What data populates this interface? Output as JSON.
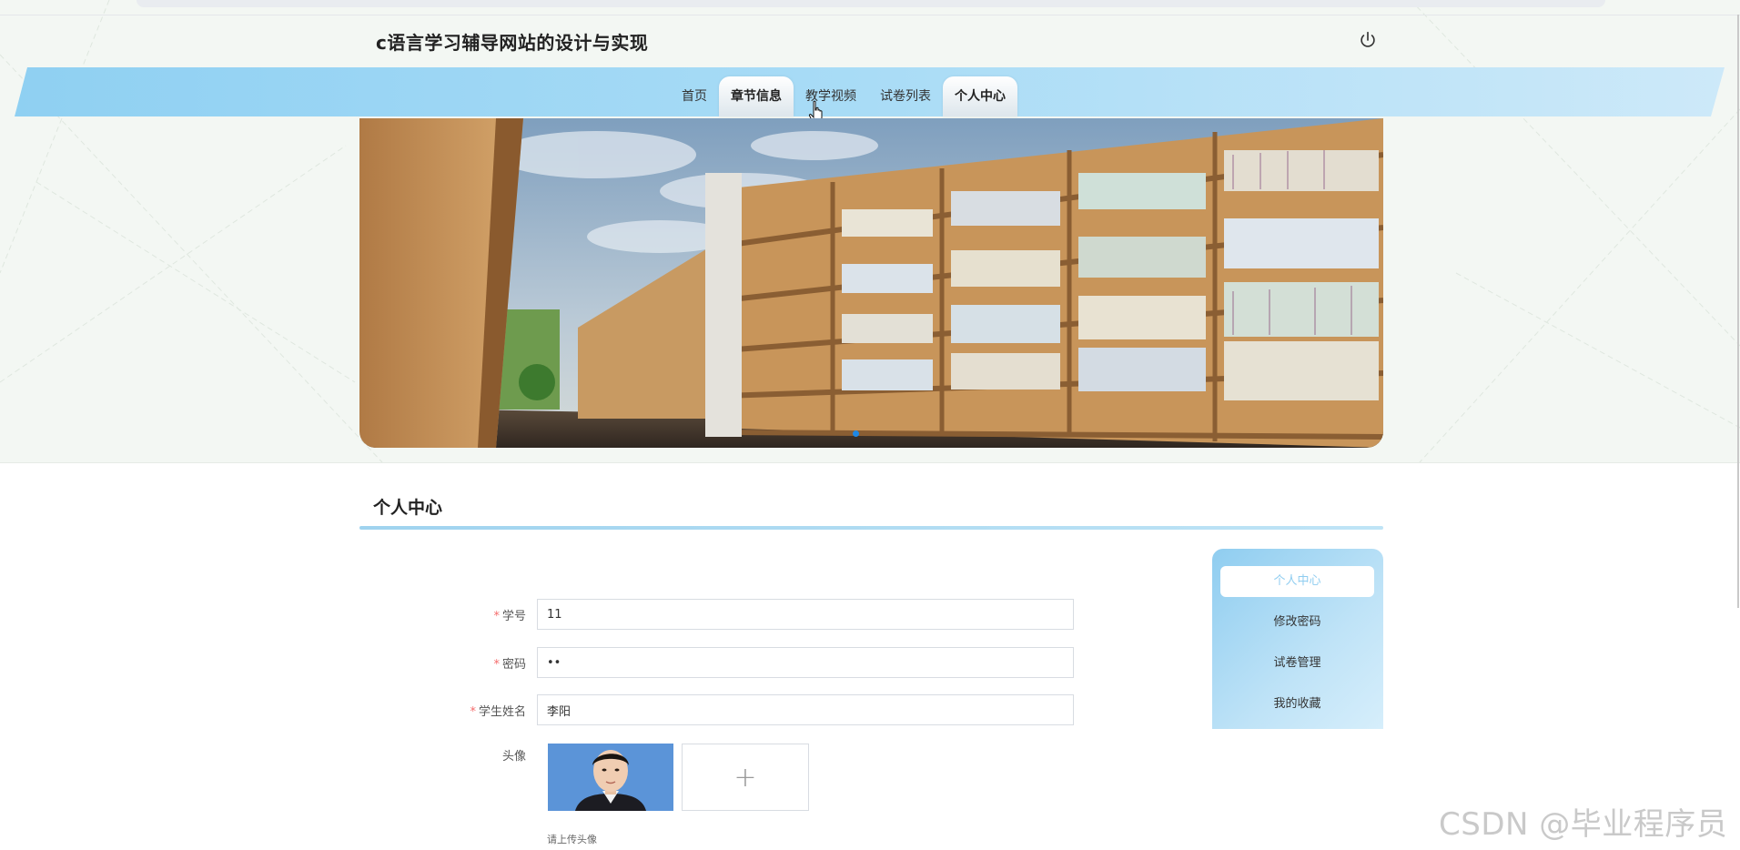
{
  "site": {
    "title": "c语言学习辅导网站的设计与实现"
  },
  "header": {
    "power_icon": "power-icon"
  },
  "nav": {
    "items": [
      {
        "label": "首页",
        "active": false
      },
      {
        "label": "章节信息",
        "active": true
      },
      {
        "label": "教学视频",
        "active": false
      },
      {
        "label": "试卷列表",
        "active": false
      },
      {
        "label": "个人中心",
        "active": true
      }
    ]
  },
  "banner": {
    "image": "library bookshelves photo",
    "slides": 1,
    "current_slide": 1
  },
  "section": {
    "title": "个人中心"
  },
  "form": {
    "student_id": {
      "label": "学号",
      "value": "11",
      "required": true
    },
    "password": {
      "label": "密码",
      "value": "••",
      "required": true
    },
    "student_name": {
      "label": "学生姓名",
      "value": "李阳",
      "required": true
    },
    "avatar": {
      "label": "头像",
      "hint": "请上传头像",
      "upload_icon": "plus-icon"
    }
  },
  "side_menu": {
    "items": [
      {
        "label": "个人中心",
        "active": true
      },
      {
        "label": "修改密码",
        "active": false
      },
      {
        "label": "试卷管理",
        "active": false
      },
      {
        "label": "我的收藏",
        "active": false
      }
    ]
  },
  "watermark": "CSDN @毕业程序员",
  "colors": {
    "accent": "#8fcdf0",
    "required": "#f56c6c",
    "dot": "#1e88e5"
  }
}
